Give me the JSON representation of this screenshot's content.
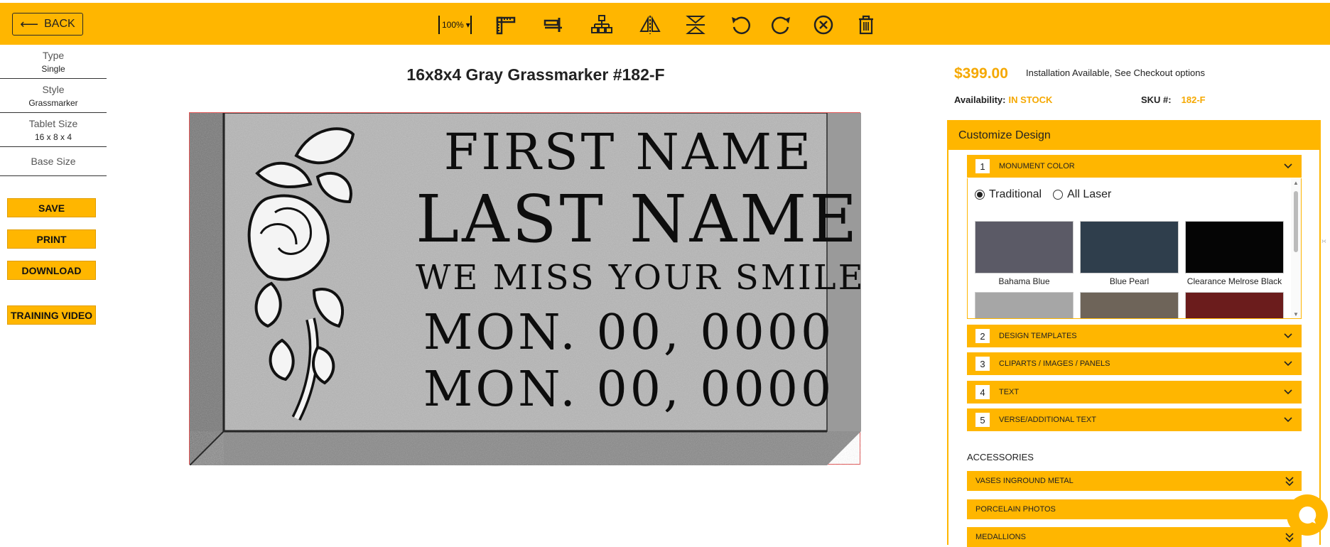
{
  "toolbar": {
    "back_label": "BACK",
    "zoom_value": "100%",
    "tools": [
      "ruler-icon",
      "align-icon",
      "hierarchy-icon",
      "flip-horizontal-icon",
      "flip-vertical-icon",
      "undo-icon",
      "redo-icon",
      "cancel-icon",
      "trash-icon"
    ]
  },
  "left": {
    "props": [
      {
        "title": "Type",
        "value": "Single"
      },
      {
        "title": "Style",
        "value": "Grassmarker"
      },
      {
        "title": "Tablet Size",
        "value": "16 x 8 x 4"
      },
      {
        "title": "Base Size",
        "value": ""
      }
    ],
    "buttons": {
      "save": "SAVE",
      "print": "PRINT",
      "download": "DOWNLOAD",
      "training": "TRAINING VIDEO"
    }
  },
  "product": {
    "title": "16x8x4 Gray Grassmarker #182-F",
    "lines": [
      "FIRST NAME",
      "LAST NAME",
      "WE MISS YOUR SMILE",
      "MON. 00, 0000",
      "MON. 00, 0000"
    ]
  },
  "info": {
    "price": "$399.00",
    "installation": "Installation Available, See Checkout options",
    "availability_label": "Availability:",
    "availability_value": "IN STOCK",
    "sku_label": "SKU #:",
    "sku_value": "182-F"
  },
  "customize": {
    "header": "Customize Design",
    "steps": [
      {
        "num": "1",
        "label": "MONUMENT COLOR"
      },
      {
        "num": "2",
        "label": "DESIGN TEMPLATES"
      },
      {
        "num": "3",
        "label": "CLIPARTS / IMAGES / PANELS"
      },
      {
        "num": "4",
        "label": "TEXT"
      },
      {
        "num": "5",
        "label": "VERSE/ADDITIONAL TEXT"
      }
    ],
    "radios": {
      "traditional": "Traditional",
      "all_laser": "All Laser",
      "selected": "Traditional"
    },
    "colors": [
      "Bahama Blue",
      "Blue Pearl",
      "Clearance Melrose Black"
    ],
    "colors_hex": [
      "#5b5a66",
      "#2f3e4c",
      "#050505",
      "#a6a6a6",
      "#6e6459",
      "#6b1c1c"
    ],
    "accessories_label": "ACCESSORIES",
    "accessories": [
      "VASES INGROUND METAL",
      "PORCELAIN PHOTOS",
      "MEDALLIONS"
    ]
  },
  "theme": {
    "accent": "#ffb600",
    "price_color": "#f5a800"
  }
}
